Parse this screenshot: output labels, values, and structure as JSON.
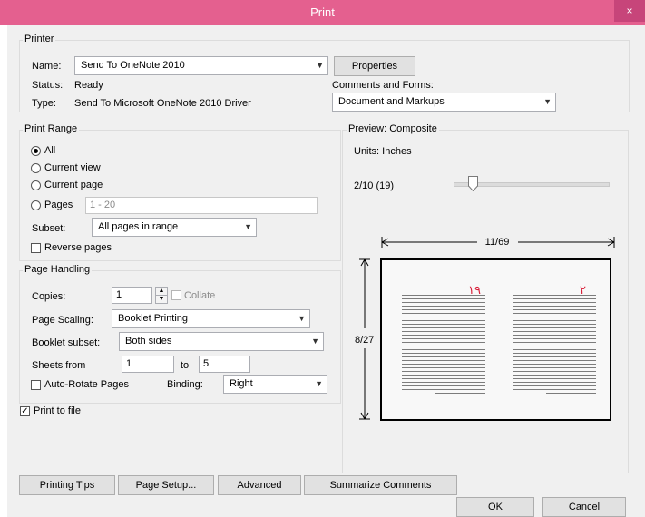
{
  "window": {
    "title": "Print",
    "close_glyph": "×"
  },
  "printer": {
    "group_title": "Printer",
    "name_label": "Name:",
    "name_value": "Send To OneNote 2010",
    "status_label": "Status:",
    "status_value": "Ready",
    "type_label": "Type:",
    "type_value": "Send To Microsoft OneNote 2010 Driver",
    "properties_label": "Properties",
    "comments_forms_label": "Comments and Forms:",
    "comments_forms_value": "Document and Markups"
  },
  "print_range": {
    "group_title": "Print Range",
    "all_label": "All",
    "current_view_label": "Current view",
    "current_page_label": "Current page",
    "pages_label": "Pages",
    "pages_value": "1 - 20",
    "selected": "All",
    "subset_label": "Subset:",
    "subset_value": "All pages in range",
    "reverse_pages_label": "Reverse pages"
  },
  "page_handling": {
    "group_title": "Page Handling",
    "copies_label": "Copies:",
    "copies_value": "1",
    "collate_label": "Collate",
    "page_scaling_label": "Page Scaling:",
    "page_scaling_value": "Booklet Printing",
    "booklet_subset_label": "Booklet subset:",
    "booklet_subset_value": "Both sides",
    "sheets_from_label": "Sheets from",
    "sheets_from_value": "1",
    "sheets_to_label": "to",
    "sheets_to_value": "5",
    "auto_rotate_label": "Auto-Rotate Pages",
    "binding_label": "Binding:",
    "binding_value": "Right"
  },
  "print_to_file": {
    "label": "Print to file",
    "checked": true
  },
  "preview": {
    "group_title": "Preview: Composite",
    "units_label": "Units: Inches",
    "page_indicator": "2/10 (19)",
    "width_label": "11/69",
    "height_label": "8/27",
    "left_page_number": "۱۹",
    "right_page_number": "۲"
  },
  "buttons": {
    "printing_tips": "Printing Tips",
    "page_setup": "Page Setup...",
    "advanced": "Advanced",
    "summarize_comments": "Summarize Comments",
    "ok": "OK",
    "cancel": "Cancel"
  },
  "colors": {
    "titlebar": "#e4608f",
    "accent_number": "#d9203a"
  }
}
